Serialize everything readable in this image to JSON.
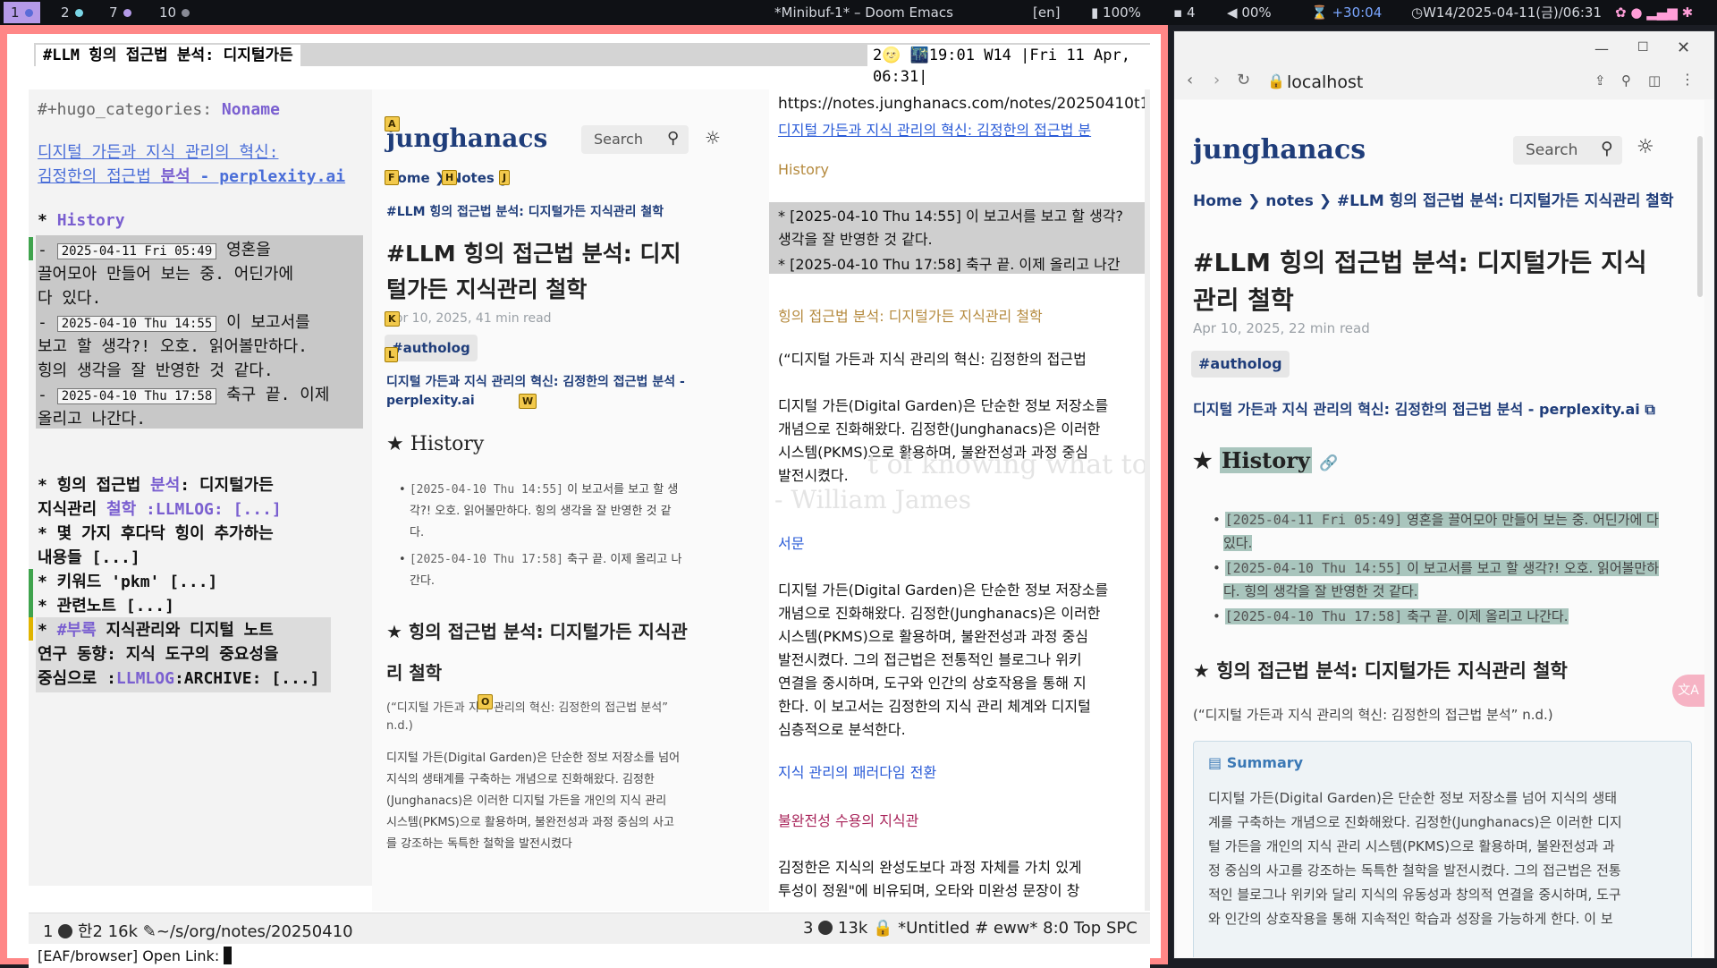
{
  "topbar": {
    "workspaces": [
      {
        "label": "1",
        "dot": "#8ea4ff"
      },
      {
        "label": "2",
        "dot": "#7ad6e6"
      },
      {
        "label": "7",
        "dot": "#b49ae8"
      },
      {
        "label": "10",
        "dot": "#888a95"
      }
    ],
    "window_title": "*Minibuf-1* – Doom Emacs",
    "lang": "[en]",
    "battery": "100%",
    "notifications": "4",
    "volume": "00%",
    "timer": "+30:04",
    "clock": "W14/2025-04-11(금)/06:31"
  },
  "emacs": {
    "header_title": "#LLM 힝의 접근법 분석: 디지털가든",
    "header_right": "2🌝 🌃19:01 W14 |Fri 11 Apr, 06:31|",
    "org": {
      "line_cat": "#+hugo_categories: ",
      "line_cat_val": "Noname",
      "link_1": "디지털 가든과 지식 관리의 혁신:",
      "link_2a": "김정한의 접근법 ",
      "link_2b": "분석",
      "link_2c": " - perplexity.ai",
      "history_star": "* ",
      "history": "History",
      "e1_ts": "2025-04-11 Fri  05:49",
      "e1_a": " 영혼을",
      "e1_b": "끌어모아 만들어 보는 중. 어딘가에",
      "e1_c": "다 있다.",
      "e2_ts": "2025-04-10 Thu  14:55",
      "e2_a": " 이 보고서를",
      "e2_b": "보고 할 생각?! 오호. 읽어볼만하다.",
      "e2_c": "  힝의 생각을 잘 반영한 것 같다.",
      "e3_ts": "2025-04-10 Thu  17:58",
      "e3_a": " 축구 끝. 이제",
      "e3_b": "올리고 나간다.",
      "h1_a": "* 힝의 접근법 ",
      "h1_b": "분석",
      "h1_c": ": 디지털가든",
      "h1_d": "지식관리 ",
      "h1_e": "철학",
      "h1_f": " :LLMLOG: [...]",
      "h2_a": "* 몇 가지 후다닥 힝이 추가하는",
      "h2_b": "내용들 [...]",
      "h3": "* 키워드 'pkm' [...]",
      "h4": "* 관련노트 [...]",
      "h5_a": "* ",
      "h5_b": "#부록",
      "h5_c": " 지식관리와 디지털 노트",
      "h5_d": "연구 동향: 지식 도구의 중요성을",
      "h5_e": "중심으로 :",
      "h5_f": "LLMLOG",
      "h5_g": ":ARCHIVE: [...]"
    },
    "mid": {
      "site_title": "junghanacs",
      "search": "Search",
      "bc_home": "Home",
      "bc_notes": "Notes",
      "bc_page": "#LLM 힝의 접근법 분석: 디지털가든 지식관리 철학",
      "title_1": "#LLM 힝의 접근법 분석: 디지",
      "title_2": "털가든 지식관리 철학",
      "meta": "Apr 10, 2025,  41 min read",
      "tag": "#autholog",
      "link_1": "디지털 가든과 지식 관리의 혁신: 김정한의 접근법 분석 -",
      "link_2": "perplexity.ai",
      "h_history": "History",
      "li1_ts": "[2025-04-10 Thu 14:55]",
      "li1_a": " 이 보고서를 보고 할 생",
      "li1_b": "각?! 오호. 읽어볼만하다. 힝의 생각을 잘 반영한 것 같",
      "li1_c": "다.",
      "li2_ts": "[2025-04-10 Thu 17:58]",
      "li2_a": " 축구 끝. 이제 올리고 나",
      "li2_b": "간다.",
      "h2_a": "힝의 접근법 분석: 디지털가든 지식관",
      "h2_b": "리 철학",
      "cite_1": "(“디지털 가든과 지식 관리의 혁신: 김정한의 접근법 분석”",
      "cite_2": "n.d.)",
      "p1": "디지털 가든(Digital Garden)은 단순한 정보 저장소를 넘어",
      "p2": "지식의 생태계를 구축하는 개념으로 진화해왔다. 김정한",
      "p3": "(Junghanacs)은 이러한 디지털 가든을 개인의 지식 관리",
      "p4": "시스템(PKMS)으로 활용하며, 불완전성과 과정 중심의 사고",
      "p5": "를 강조하는 독특한 철학을 발전시켰다",
      "hints": [
        "A",
        "F",
        "H",
        "J",
        "K",
        "L",
        "W",
        "O"
      ]
    },
    "eww": {
      "url": "https://notes.junghanacs.com/notes/20250410t1",
      "link_top": "디지털 가든과 지식 관리의 혁신: 김정한의 접근법 분",
      "history": "History",
      "hl1_a": "* [2025-04-10 Thu 14:55] 이 보고서를 보고 할 생각?",
      "hl1_b": "  생각을 잘 반영한 것 같다.",
      "hl2": "* [2025-04-10 Thu 17:58] 축구 끝. 이제 올리고 나간",
      "heading": "힝의 접근법 분석: 디지털가든 지식관리 철학",
      "cite": "(“디지털 가든과 지식 관리의 혁신: 김정한의 접근법",
      "a1": "디지털 가든(Digital Garden)은 단순한 정보 저장소를",
      "a2": "개념으로 진화해왔다. 김정한(Junghanacs)은 이러한",
      "a3": "시스템(PKMS)으로 활용하며, 불완전성과 과정 중심",
      "a4": "발전시켰다.",
      "ghost1": "t of knowing what to ov",
      "ghost2": "- William James",
      "sec_intro": "서문",
      "b1": "디지털 가든(Digital Garden)은 단순한 정보 저장소를",
      "b2": "개념으로 진화해왔다. 김정한(Junghanacs)은 이러한",
      "b3": "시스템(PKMS)으로 활용하며, 불완전성과 과정 중심",
      "b4": "발전시켰다. 그의 접근법은 전통적인 블로그나 위키",
      "b5": "연결을 중시하며, 도구와 인간의 상호작용을 통해 지",
      "b6": "한다. 이 보고서는 김정한의 지식 관리 체계와 디지털",
      "b7": "심층적으로 분석한다.",
      "sec_paradigm": "지식 관리의 패러다임 전환",
      "sec_imperfect": "불완전성 수용의 지식관",
      "c1": "김정한은 지식의 완성도보다 과정 자체를 가치 있게",
      "c2": "투성이 정원\"에 비유되며, 오타와 미완성 문장이 창"
    },
    "modeline_left": {
      "num": "1",
      "enc": "한2",
      "size": "16k",
      "path": "~/s/org/notes/20250410"
    },
    "modeline_right": {
      "num": "3",
      "size": "13k",
      "buf": "*Untitled # eww*",
      "pos": "8:0 Top",
      "mode": "SPC"
    },
    "minibuffer": "[EAF/browser] Open Link: "
  },
  "browser": {
    "address": "localhost",
    "site_title": "junghanacs",
    "search": "Search",
    "bc_home": "Home",
    "bc_notes": "notes",
    "bc_page": "#LLM 힝의 접근법 분석: 디지털가든 지식관리 철학",
    "title_1": "#LLM 힝의 접근법 분석: 디지털가든 지식",
    "title_2": "관리 철학",
    "meta": "Apr 10, 2025,  22 min read",
    "tag": "#autholog",
    "link": "디지털 가든과 지식 관리의 혁신: 김정한의 접근법 분석 - perplexity.ai",
    "history": "History",
    "li1_ts": "[2025-04-11 Fri 05:49]",
    "li1_a": " 영혼을 끌어모아 만들어 보는 중. 어딘가에 다",
    "li1_b": "있다.",
    "li2_ts": "[2025-04-10 Thu 14:55]",
    "li2_a": " 이 보고서를 보고 할 생각?! 오호. 읽어볼만하",
    "li2_b": "다. 힝의 생각을 잘 반영한 것 같다.",
    "li3_ts": "[2025-04-10 Thu 17:58]",
    "li3_a": " 축구 끝. 이제 올리고 나간다.",
    "h2": "힝의 접근법 분석: 디지털가든 지식관리 철학",
    "cite": "(“디지털 가든과 지식 관리의 혁신: 김정한의 접근법 분석” n.d.)",
    "summary": "Summary",
    "s1": "디지털 가든(Digital Garden)은 단순한 정보 저장소를 넘어 지식의 생태",
    "s2": "계를 구축하는 개념으로 진화해왔다. 김정한(Junghanacs)은 이러한 디지",
    "s3": "털 가든을 개인의 지식 관리 시스템(PKMS)으로 활용하며, 불완전성과 과",
    "s4": "정 중심의 사고를 강조하는 독특한 철학을 발전시켰다. 그의 접근법은 전통",
    "s5": "적인 블로그나 위키와 달리 지식의 유동성과 창의적 연결을 중시하며, 도구",
    "s6": "와 인간의 상호작용을 통해 지속적인 학습과 성장을 가능하게 한다. 이 보"
  },
  "colors": {
    "accent": "#ff8787",
    "ws_active": "#b49ae8",
    "link": "#1f3d7a",
    "org_kw": "#7a5fd0"
  }
}
